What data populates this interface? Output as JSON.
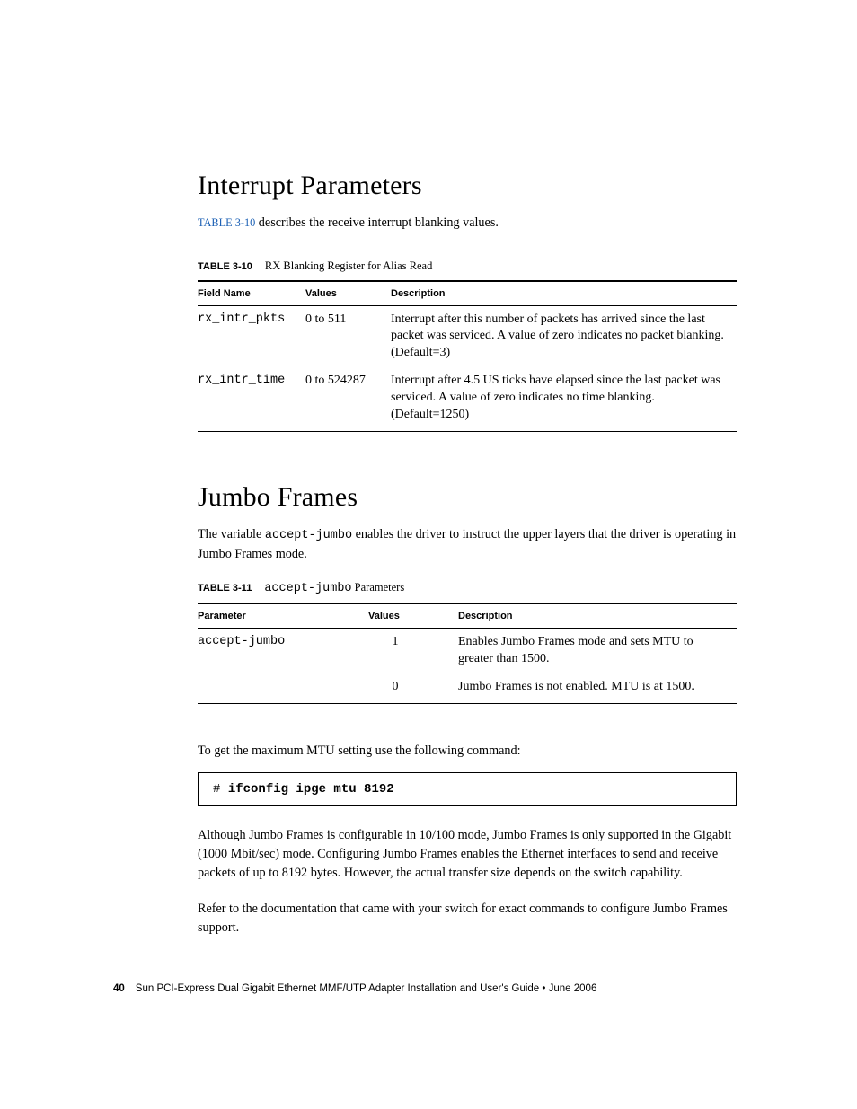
{
  "section1": {
    "heading": "Interrupt Parameters",
    "intro_xref": "TABLE 3-10",
    "intro_rest": " describes the receive interrupt blanking values.",
    "table": {
      "caption_label": "TABLE 3-10",
      "caption_text": "RX Blanking Register for Alias Read",
      "headers": {
        "c1": "Field Name",
        "c2": "Values",
        "c3": "Description"
      },
      "rows": [
        {
          "name": "rx_intr_pkts",
          "values": "0 to 511",
          "desc": "Interrupt after this number of packets has arrived since the last packet was serviced. A value of zero indicates no packet blanking. (Default=3)"
        },
        {
          "name": "rx_intr_time",
          "values": "0 to 524287",
          "desc": "Interrupt after 4.5 US ticks have elapsed since the last packet was serviced. A value of zero indicates no time blanking. (Default=1250)"
        }
      ]
    }
  },
  "section2": {
    "heading": "Jumbo Frames",
    "intro_pre": "The variable ",
    "intro_code": "accept-jumbo",
    "intro_post": " enables the driver to instruct the upper layers that the driver is operating in Jumbo Frames mode.",
    "table": {
      "caption_label": "TABLE 3-11",
      "caption_code": "accept-jumbo",
      "caption_text": " Parameters",
      "headers": {
        "c1": "Parameter",
        "c2": "Values",
        "c3": "Description"
      },
      "rows": [
        {
          "name": "accept-jumbo",
          "values": "1",
          "desc": "Enables Jumbo Frames mode and sets MTU to greater than 1500."
        },
        {
          "name": "",
          "values": "0",
          "desc": "Jumbo Frames is not enabled. MTU is at 1500."
        }
      ]
    },
    "para1": "To get the maximum MTU setting use the following command:",
    "code_prompt": "# ",
    "code_cmd": "ifconfig ipge mtu 8192",
    "para2": "Although Jumbo Frames is configurable in 10/100 mode, Jumbo Frames is only supported in the Gigabit (1000 Mbit/sec) mode. Configuring Jumbo Frames enables the Ethernet interfaces to send and receive packets of up to 8192 bytes. However, the actual transfer size depends on the switch capability.",
    "para3": "Refer to the documentation that came with your switch for exact commands to configure Jumbo Frames support."
  },
  "footer": {
    "page": "40",
    "title": "Sun PCI-Express Dual Gigabit Ethernet MMF/UTP Adapter Installation and User's Guide  •  June 2006"
  }
}
